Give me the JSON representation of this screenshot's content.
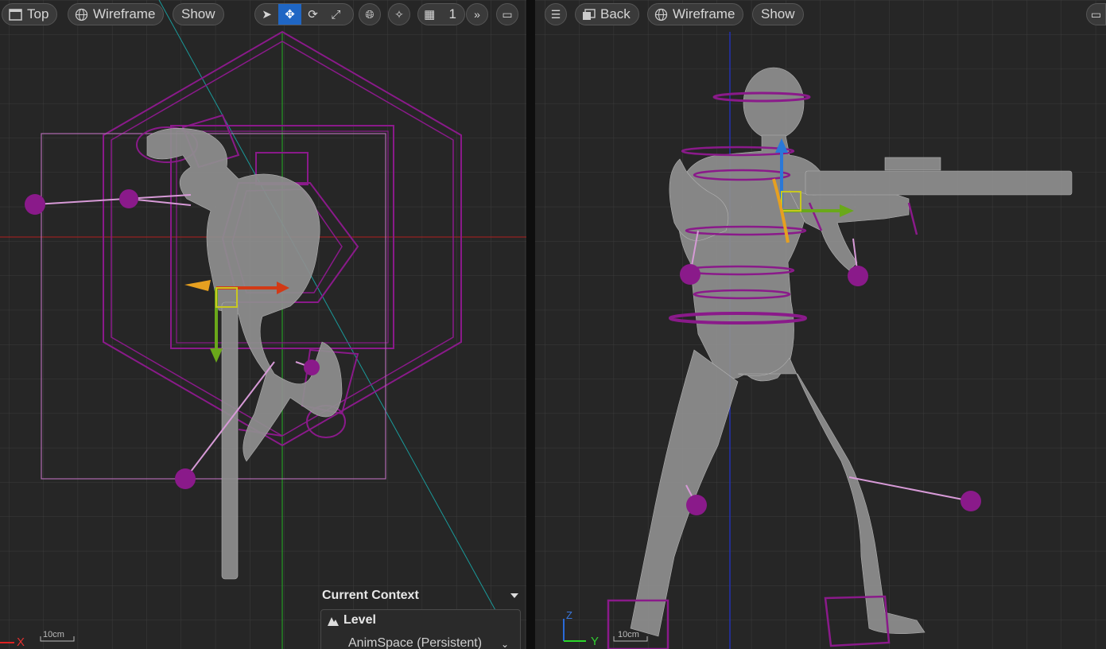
{
  "left_viewport": {
    "toolbar": {
      "view_mode": "Top",
      "render_mode": "Wireframe",
      "show_label": "Show",
      "grid_snap_value": "1"
    },
    "scale_label": "10cm",
    "axis_label": "X",
    "context_panel": {
      "title": "Current Context",
      "level_label": "Level",
      "world_name": "AnimSpace (Persistent)"
    }
  },
  "right_viewport": {
    "toolbar": {
      "view_mode": "Back",
      "render_mode": "Wireframe",
      "show_label": "Show"
    },
    "scale_label": "10cm",
    "axis_z_label": "Z",
    "axis_y_label": "Y"
  },
  "colors": {
    "viewport_bg": "#262626",
    "grid": "#3c3c3c",
    "physics_body": "#8a1a8a",
    "mesh": "#a8a8a8",
    "accent_active": "#1f66c4"
  }
}
